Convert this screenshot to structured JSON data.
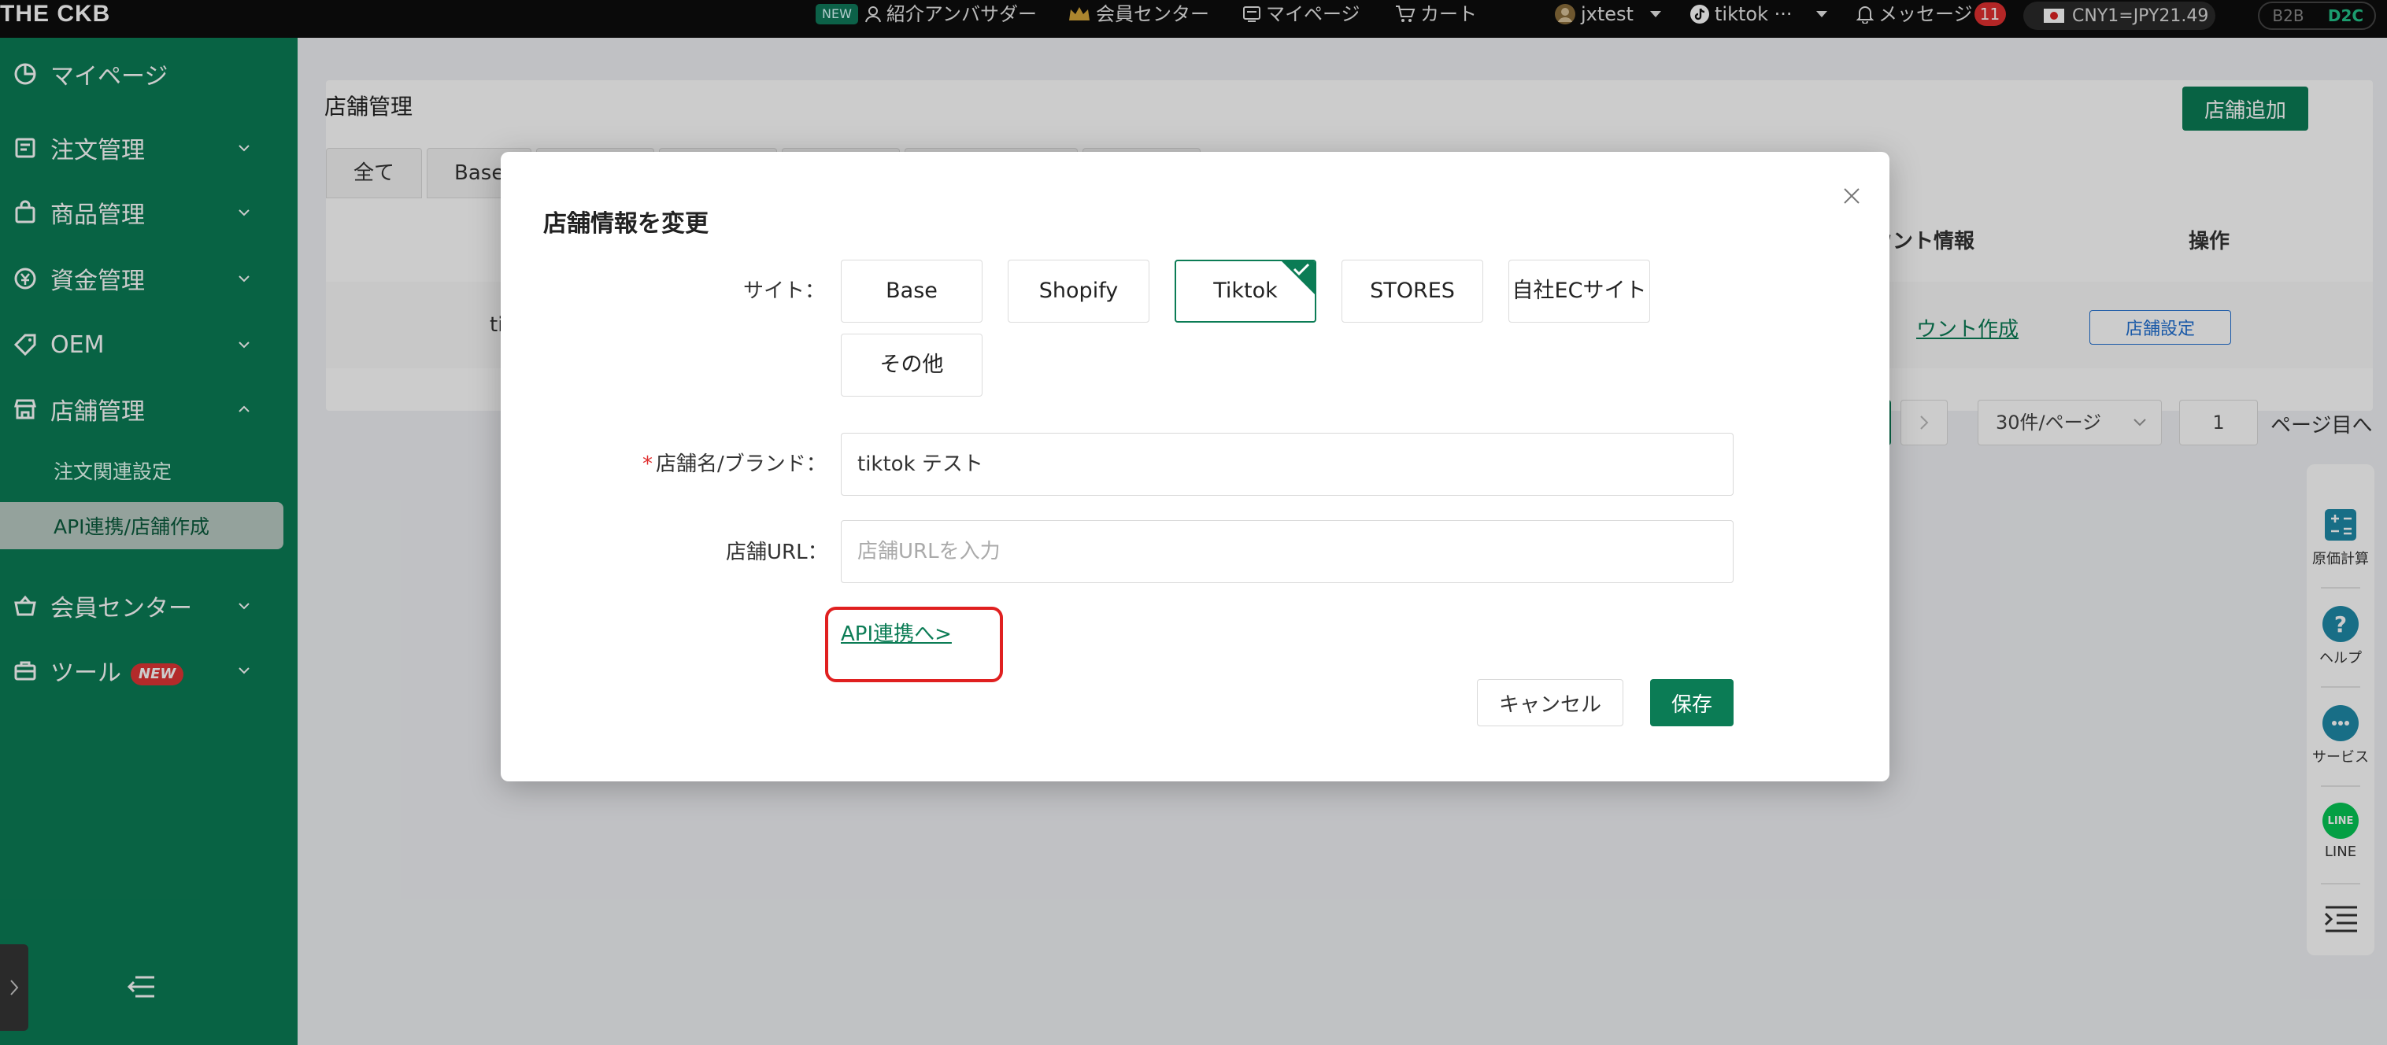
{
  "topbar": {
    "logo": "THE CKB",
    "new_badge": "NEW",
    "ambassador": "紹介アンバサダー",
    "member_center": "会員センター",
    "mypage": "マイページ",
    "cart": "カート",
    "user": "jxtest",
    "tiktok": "tiktok ···",
    "messages": "メッセージ",
    "message_count": "11",
    "rate": "CNY1=JPY21.49",
    "mode_b2b": "B2B",
    "mode_d2c": "D2C"
  },
  "sidebar": {
    "mypage": "マイページ",
    "orders": "注文管理",
    "products": "商品管理",
    "funds": "資金管理",
    "oem": "OEM",
    "stores": "店舗管理",
    "sub_order_settings": "注文関連設定",
    "sub_api": "API連携/店舗作成",
    "member": "会員センター",
    "tools": "ツール",
    "tools_badge": "NEW"
  },
  "main": {
    "title": "店舗管理",
    "add_store": "店舗追加",
    "tabs": [
      "全て",
      "Base"
    ],
    "col_account": "ウント情報",
    "col_ops": "操作",
    "row_store": "tiktc",
    "row_link": "ウント作成",
    "row_btn": "店舗設定",
    "page_size": "30件/ページ",
    "page_input": "1",
    "page_go": "ページ目へ"
  },
  "float_bar": {
    "cost": "原価計算",
    "help": "ヘルプ",
    "service": "サービス",
    "line": "LINE",
    "line_icon_text": "LINE"
  },
  "modal": {
    "title": "店舗情報を変更",
    "site_label": "サイト：",
    "sites": [
      "Base",
      "Shopify",
      "Tiktok",
      "STORES",
      "自社ECサイト",
      "その他"
    ],
    "selected_site": "Tiktok",
    "name_label": "店舗名/ブランド：",
    "required_mark": "*",
    "name_value": "tiktok テスト",
    "url_label": "店舗URL：",
    "url_placeholder": "店舗URLを入力",
    "api_link": "API連携へ>",
    "cancel": "キャンセル",
    "save": "保存"
  },
  "colors": {
    "brand_green": "#0b7c55",
    "highlight_red": "#e02020",
    "badge_red": "#e03030"
  }
}
